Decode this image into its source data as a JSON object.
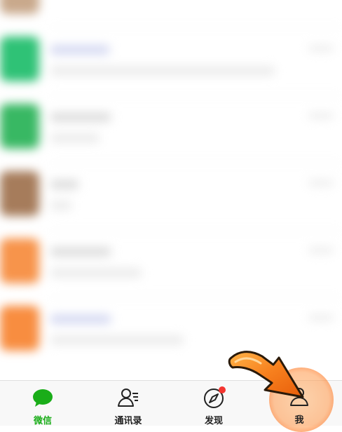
{
  "colors": {
    "accent": "#1aad19",
    "badge": "#f43530",
    "highlight": "#ff8a3d",
    "arrow": "#f06a0f"
  },
  "tabs": [
    {
      "label": "微信",
      "icon": "chat-bubble-icon",
      "active": true
    },
    {
      "label": "通讯录",
      "icon": "contacts-icon",
      "active": false
    },
    {
      "label": "发现",
      "icon": "compass-icon",
      "active": false,
      "badge": true
    },
    {
      "label": "我",
      "icon": "person-icon",
      "active": false
    }
  ]
}
